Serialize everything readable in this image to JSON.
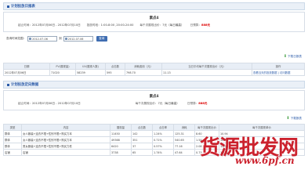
{
  "daily_report": {
    "tab": "计划投放日报表",
    "title": "素点4",
    "start_label": "起止时间：",
    "start_value": "2012年07月06日 - 2012年07月10日",
    "hours_label": "投放时段：",
    "hours_value": "1:00-8:00 ,20:00-24:00",
    "daily_limit_label": "每千次展现出价：",
    "daily_limit_value": "7元（每日最高）",
    "budget_label": "日预算：",
    "budget_value": "888元"
  },
  "query": {
    "label": "查询时间范围：",
    "from": "2012-07-06",
    "to_label": "到",
    "to": "2012-07-06",
    "button": "查询"
  },
  "summary": {
    "export_link": "下载日报表",
    "headers": [
      "日期",
      "PV(展现量)",
      "UV(展现人数)",
      "点击数",
      "消耗费用（元）",
      "当日平均每千次展现出价（元）",
      "操作"
    ],
    "row": [
      "2012年07月06日",
      "71020",
      "58239",
      "595",
      "798.70",
      "11.13",
      "查看当天的投放数据 | 访问数据"
    ]
  },
  "effect_report": {
    "tab": "计划投放定向数据",
    "title": "素点4",
    "start_label": "起止时间：",
    "start_value": "2012年07月06日 - 2012年07月10日",
    "daily_limit_label": "每千次展现出价：",
    "daily_limit_value": "7元（每日最高）",
    "budget_label": "日预算：",
    "budget_value": "888元",
    "export_link": "下载报表"
  },
  "detail": {
    "headers": [
      "类型",
      "内容",
      "展现量",
      "点击数",
      "点击率",
      "消耗",
      "每千次展现出价",
      "每千次展现单价"
    ],
    "rows": [
      [
        "群体",
        "女人服装+连衣不限+性别不限+购买力本",
        "11450",
        "142",
        "1.24%",
        "125.31",
        "8.60",
        "10.94"
      ],
      [
        "群体",
        "女人服装+连衣不限+性别不限+购买力本",
        "49368",
        "351",
        "0.71%",
        "540.65",
        "1.54",
        "10.95"
      ],
      [
        "群体",
        "男女服装+连衣不限+性别不限+购买力低",
        "6420",
        "37",
        "0.57%",
        "77.16",
        "2.08",
        "12.02"
      ],
      [
        "店铺",
        "店铺",
        "3738",
        "65",
        "1.74%",
        "47.64",
        "0.73",
        "12.75"
      ]
    ]
  },
  "watermark": {
    "cn": "货源批发网",
    "en": "www.6pf.cn"
  }
}
